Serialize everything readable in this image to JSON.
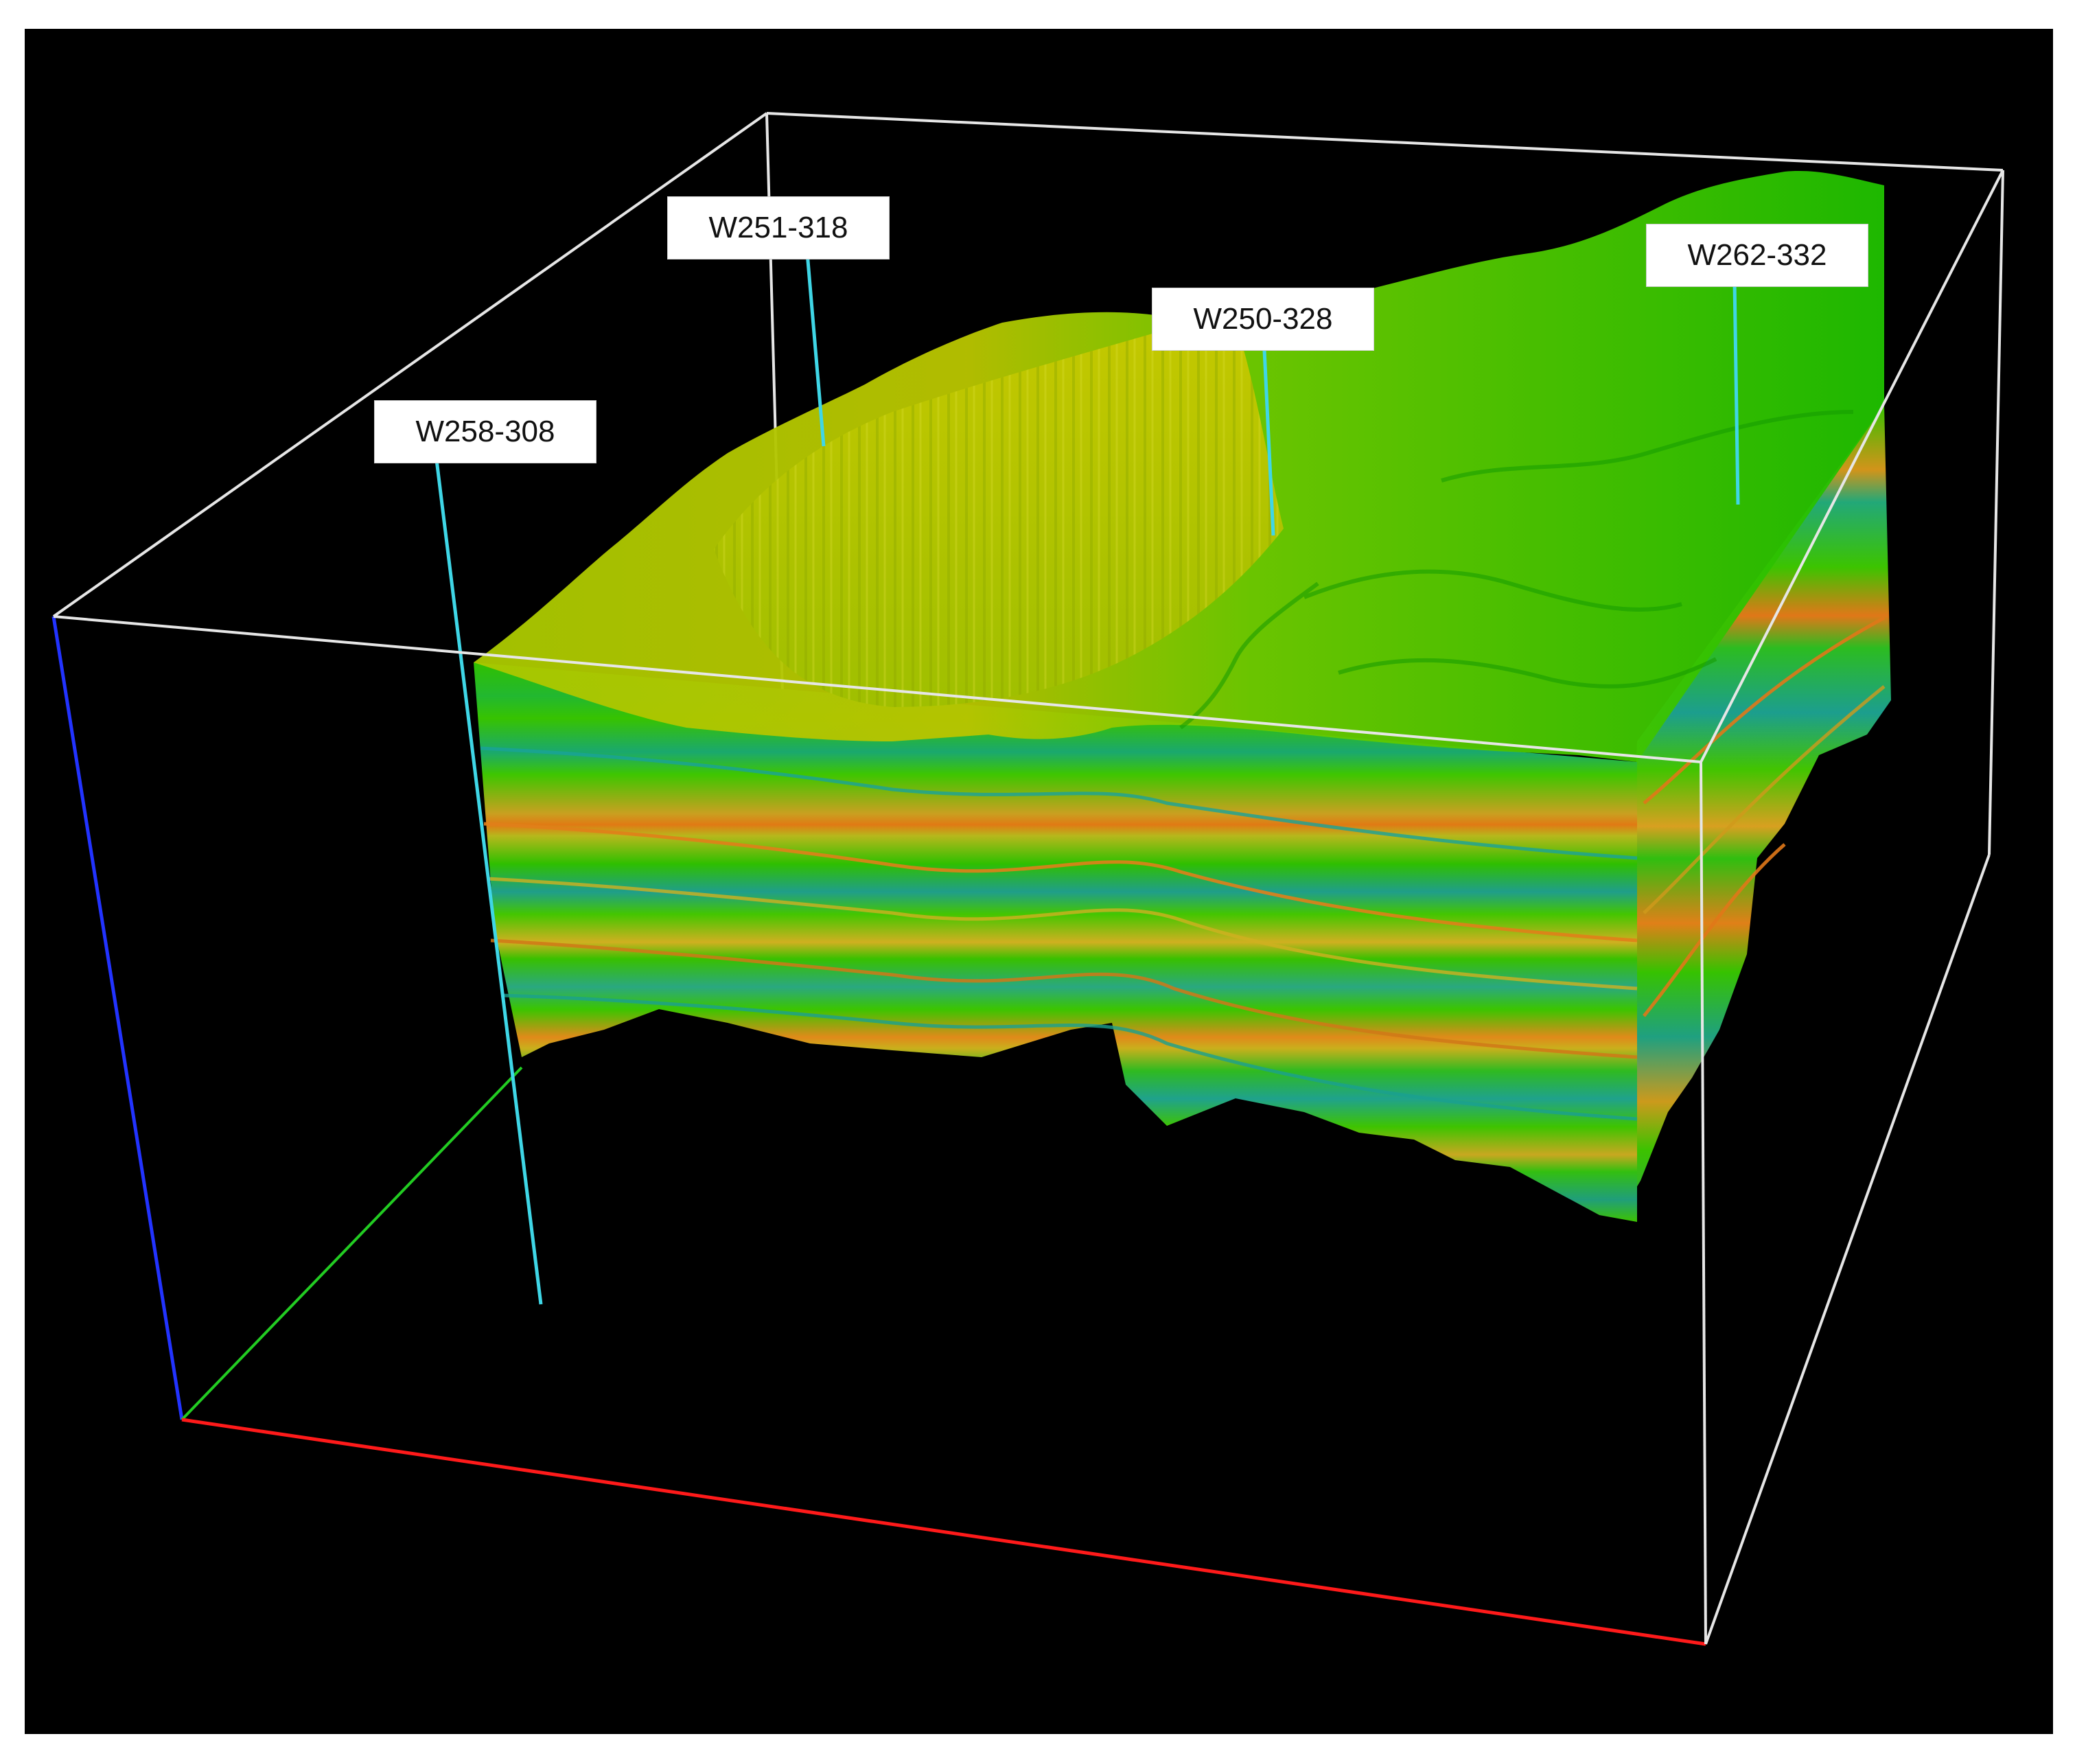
{
  "background_color": "#000000",
  "well_color": "#3fd6e6",
  "axis_colors": {
    "x": "#ff1a1a",
    "y": "#22cc22",
    "z": "#2233ff"
  },
  "bounding_box_color": "#e6e6e6",
  "wells": [
    {
      "label": "W251-318"
    },
    {
      "label": "W250-328"
    },
    {
      "label": "W262-332"
    },
    {
      "label": "W258-308"
    }
  ]
}
